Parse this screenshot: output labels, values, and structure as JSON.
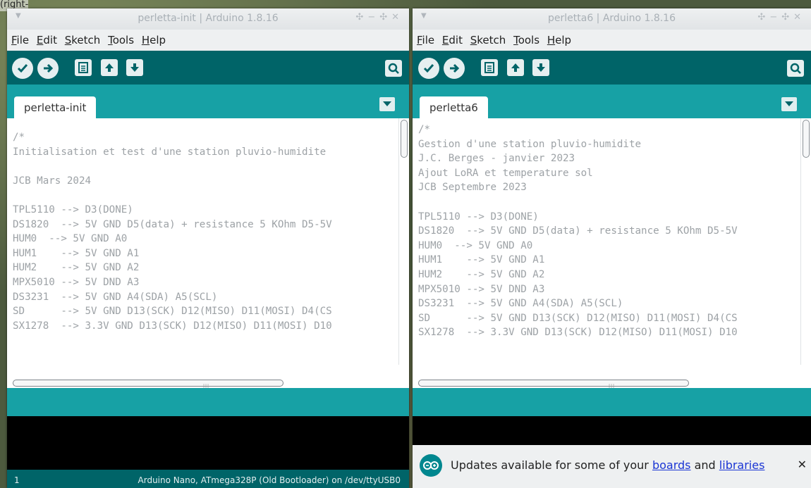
{
  "background_hint": "(right-click)",
  "colors": {
    "toolbar": "#006468",
    "tabbar": "#17a1a5",
    "code_text": "#9da2a6",
    "console": "#000000",
    "link": "#1a35d4"
  },
  "menu": [
    "File",
    "Edit",
    "Sketch",
    "Tools",
    "Help"
  ],
  "toolbar_icons": [
    "verify-icon",
    "upload-icon",
    "new-icon",
    "open-icon",
    "save-icon",
    "serial-monitor-icon"
  ],
  "left": {
    "title": "perletta-init | Arduino 1.8.16",
    "tab": "perletta-init",
    "code": [
      "/*",
      "Initialisation et test d'une station pluvio-humidite",
      "",
      "JCB Mars 2024",
      "",
      "TPL5110 --> D3(DONE)",
      "DS1820  --> 5V GND D5(data) + resistance 5 KOhm D5-5V",
      "HUM0  --> 5V GND A0",
      "HUM1    --> 5V GND A1",
      "HUM2    --> 5V GND A2",
      "MPX5010 --> 5V DND A3",
      "DS3231  --> 5V GND A4(SDA) A5(SCL)",
      "SD      --> 5V GND D13(SCK) D12(MISO) D11(MOSI) D4(CS",
      "SX1278  --> 3.3V GND D13(SCK) D12(MISO) D11(MOSI) D10"
    ],
    "status_line": "1",
    "board": "Arduino Nano, ATmega328P (Old Bootloader) on /dev/ttyUSB0"
  },
  "right": {
    "title": "perletta6 | Arduino 1.8.16",
    "tab": "perletta6",
    "code": [
      "/*",
      "Gestion d'une station pluvio-humidite",
      "J.C. Berges - janvier 2023",
      "Ajout LoRA et temperature sol",
      "JCB Septembre 2023",
      "",
      "TPL5110 --> D3(DONE)",
      "DS1820  --> 5V GND D5(data) + resistance 5 KOhm D5-5V",
      "HUM0  --> 5V GND A0",
      "HUM1    --> 5V GND A1",
      "HUM2    --> 5V GND A2",
      "MPX5010 --> 5V DND A3",
      "DS3231  --> 5V GND A4(SDA) A5(SCL)",
      "SD      --> 5V GND D13(SCK) D12(MISO) D11(MOSI) D4(CS",
      "SX1278  --> 3.3V GND D13(SCK) D12(MISO) D11(MOSI) D10"
    ],
    "notification": {
      "text_before": "Updates available for some of your ",
      "link1": "boards",
      "text_between": " and ",
      "link2": "libraries",
      "close": "✕"
    }
  }
}
